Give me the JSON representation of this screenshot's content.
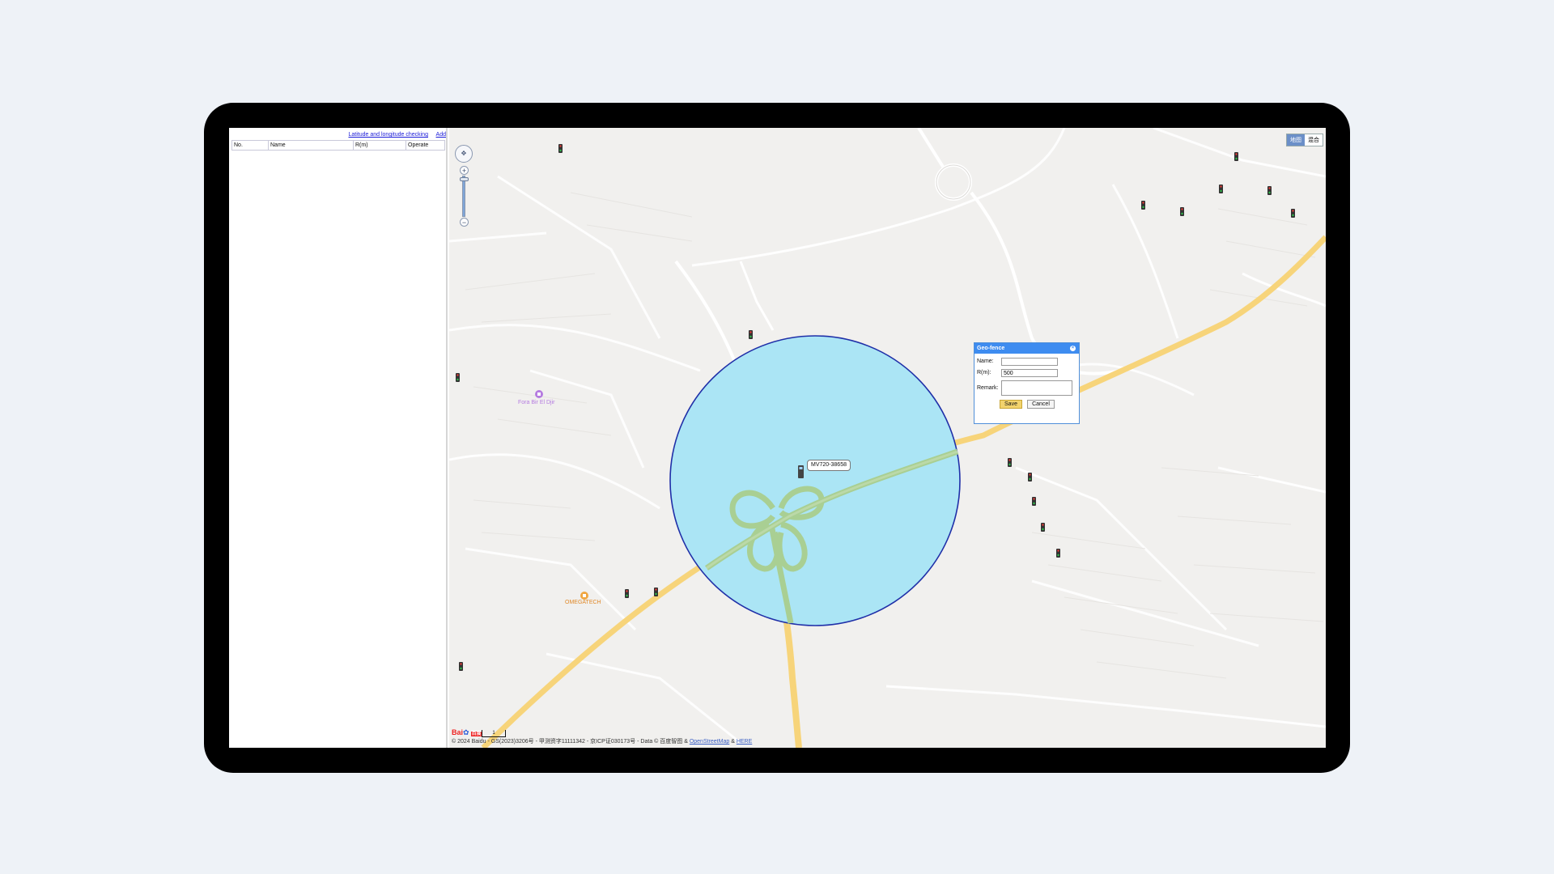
{
  "panel": {
    "link_lat_lng": "Latitude and longitude checking",
    "link_add": "Add",
    "columns": [
      "No.",
      "Name",
      "R(m)",
      "Operate"
    ]
  },
  "map": {
    "map_type_options": [
      "地图",
      "混合"
    ],
    "active_map_type": "地图",
    "vehicle_label": "MV720-38658",
    "poi_1": "Fora Bir El Djir",
    "poi_2": "OMEGATECH",
    "logo_text": "Bai",
    "logo_cn": "百度",
    "scale_text": "1",
    "footer_prefix": "© 2024 Baidu - GS(2023)3206号 - 甲测资字11111342 - 京ICP证030173号 - Data © 百度智图 &",
    "footer_link_1": "OpenStreetMap",
    "footer_amp": "&",
    "footer_link_2": "HERE",
    "colors": {
      "fence_fill": "#abe5f5",
      "fence_stroke": "#1f2fa8",
      "highway": "#f7d47a",
      "highway_in_fence": "#a9cf93"
    }
  },
  "dialog": {
    "title": "Geo-fence",
    "name_label": "Name:",
    "name_value": "",
    "radius_label": "R(m):",
    "radius_value": "500",
    "remark_label": "Remark:",
    "remark_value": "",
    "save_label": "Save",
    "cancel_label": "Cancel"
  }
}
